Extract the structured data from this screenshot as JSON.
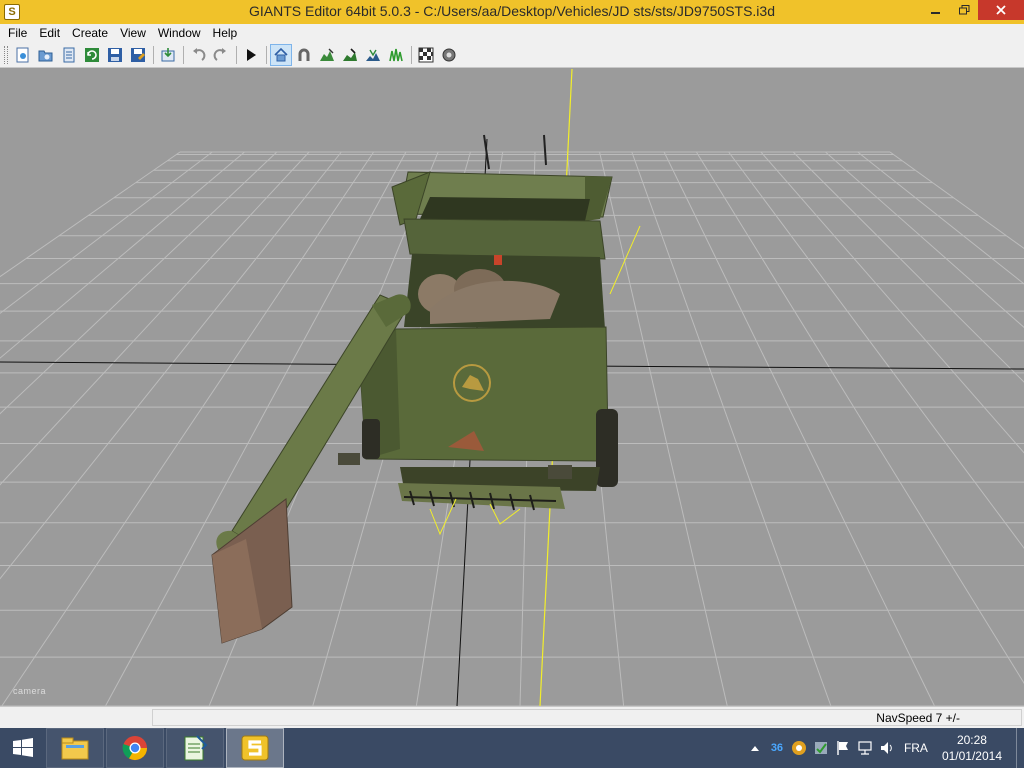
{
  "window": {
    "title": "GIANTS Editor 64bit 5.0.3 - C:/Users/aa/Desktop/Vehicles/JD sts/sts/JD9750STS.i3d",
    "app_icon_letter": "S"
  },
  "menu": [
    {
      "label": "File"
    },
    {
      "label": "Edit"
    },
    {
      "label": "Create"
    },
    {
      "label": "View"
    },
    {
      "label": "Window"
    },
    {
      "label": "Help"
    }
  ],
  "toolbar": {
    "buttons": [
      "new-scene-icon",
      "open-icon",
      "open-list-icon",
      "refresh-icon",
      "save-icon",
      "save-as-icon",
      "import-icon",
      "undo-icon",
      "redo-icon",
      "play-icon",
      "home-icon",
      "magnet-icon",
      "terrain-icon",
      "paint-icon",
      "foliage-icon",
      "grass-icon",
      "checker-icon",
      "settings-icon"
    ]
  },
  "viewport": {
    "camera_label": "camera",
    "colors": {
      "background": "#9b9b9b",
      "grid": "#b9b9b9",
      "axis_x": "#111111",
      "axis_y": "#f2ee2a",
      "machine_green": "#5a6a3a",
      "machine_tan": "#8b6d5a"
    }
  },
  "status": {
    "navspeed": "NavSpeed 7 +/-"
  },
  "taskbar": {
    "apps": [
      "file-explorer-icon",
      "chrome-icon",
      "notepad-icon",
      "giants-editor-icon"
    ],
    "tray_notification_count": "36",
    "language": "FRA",
    "time": "20:28",
    "date": "01/01/2014"
  }
}
